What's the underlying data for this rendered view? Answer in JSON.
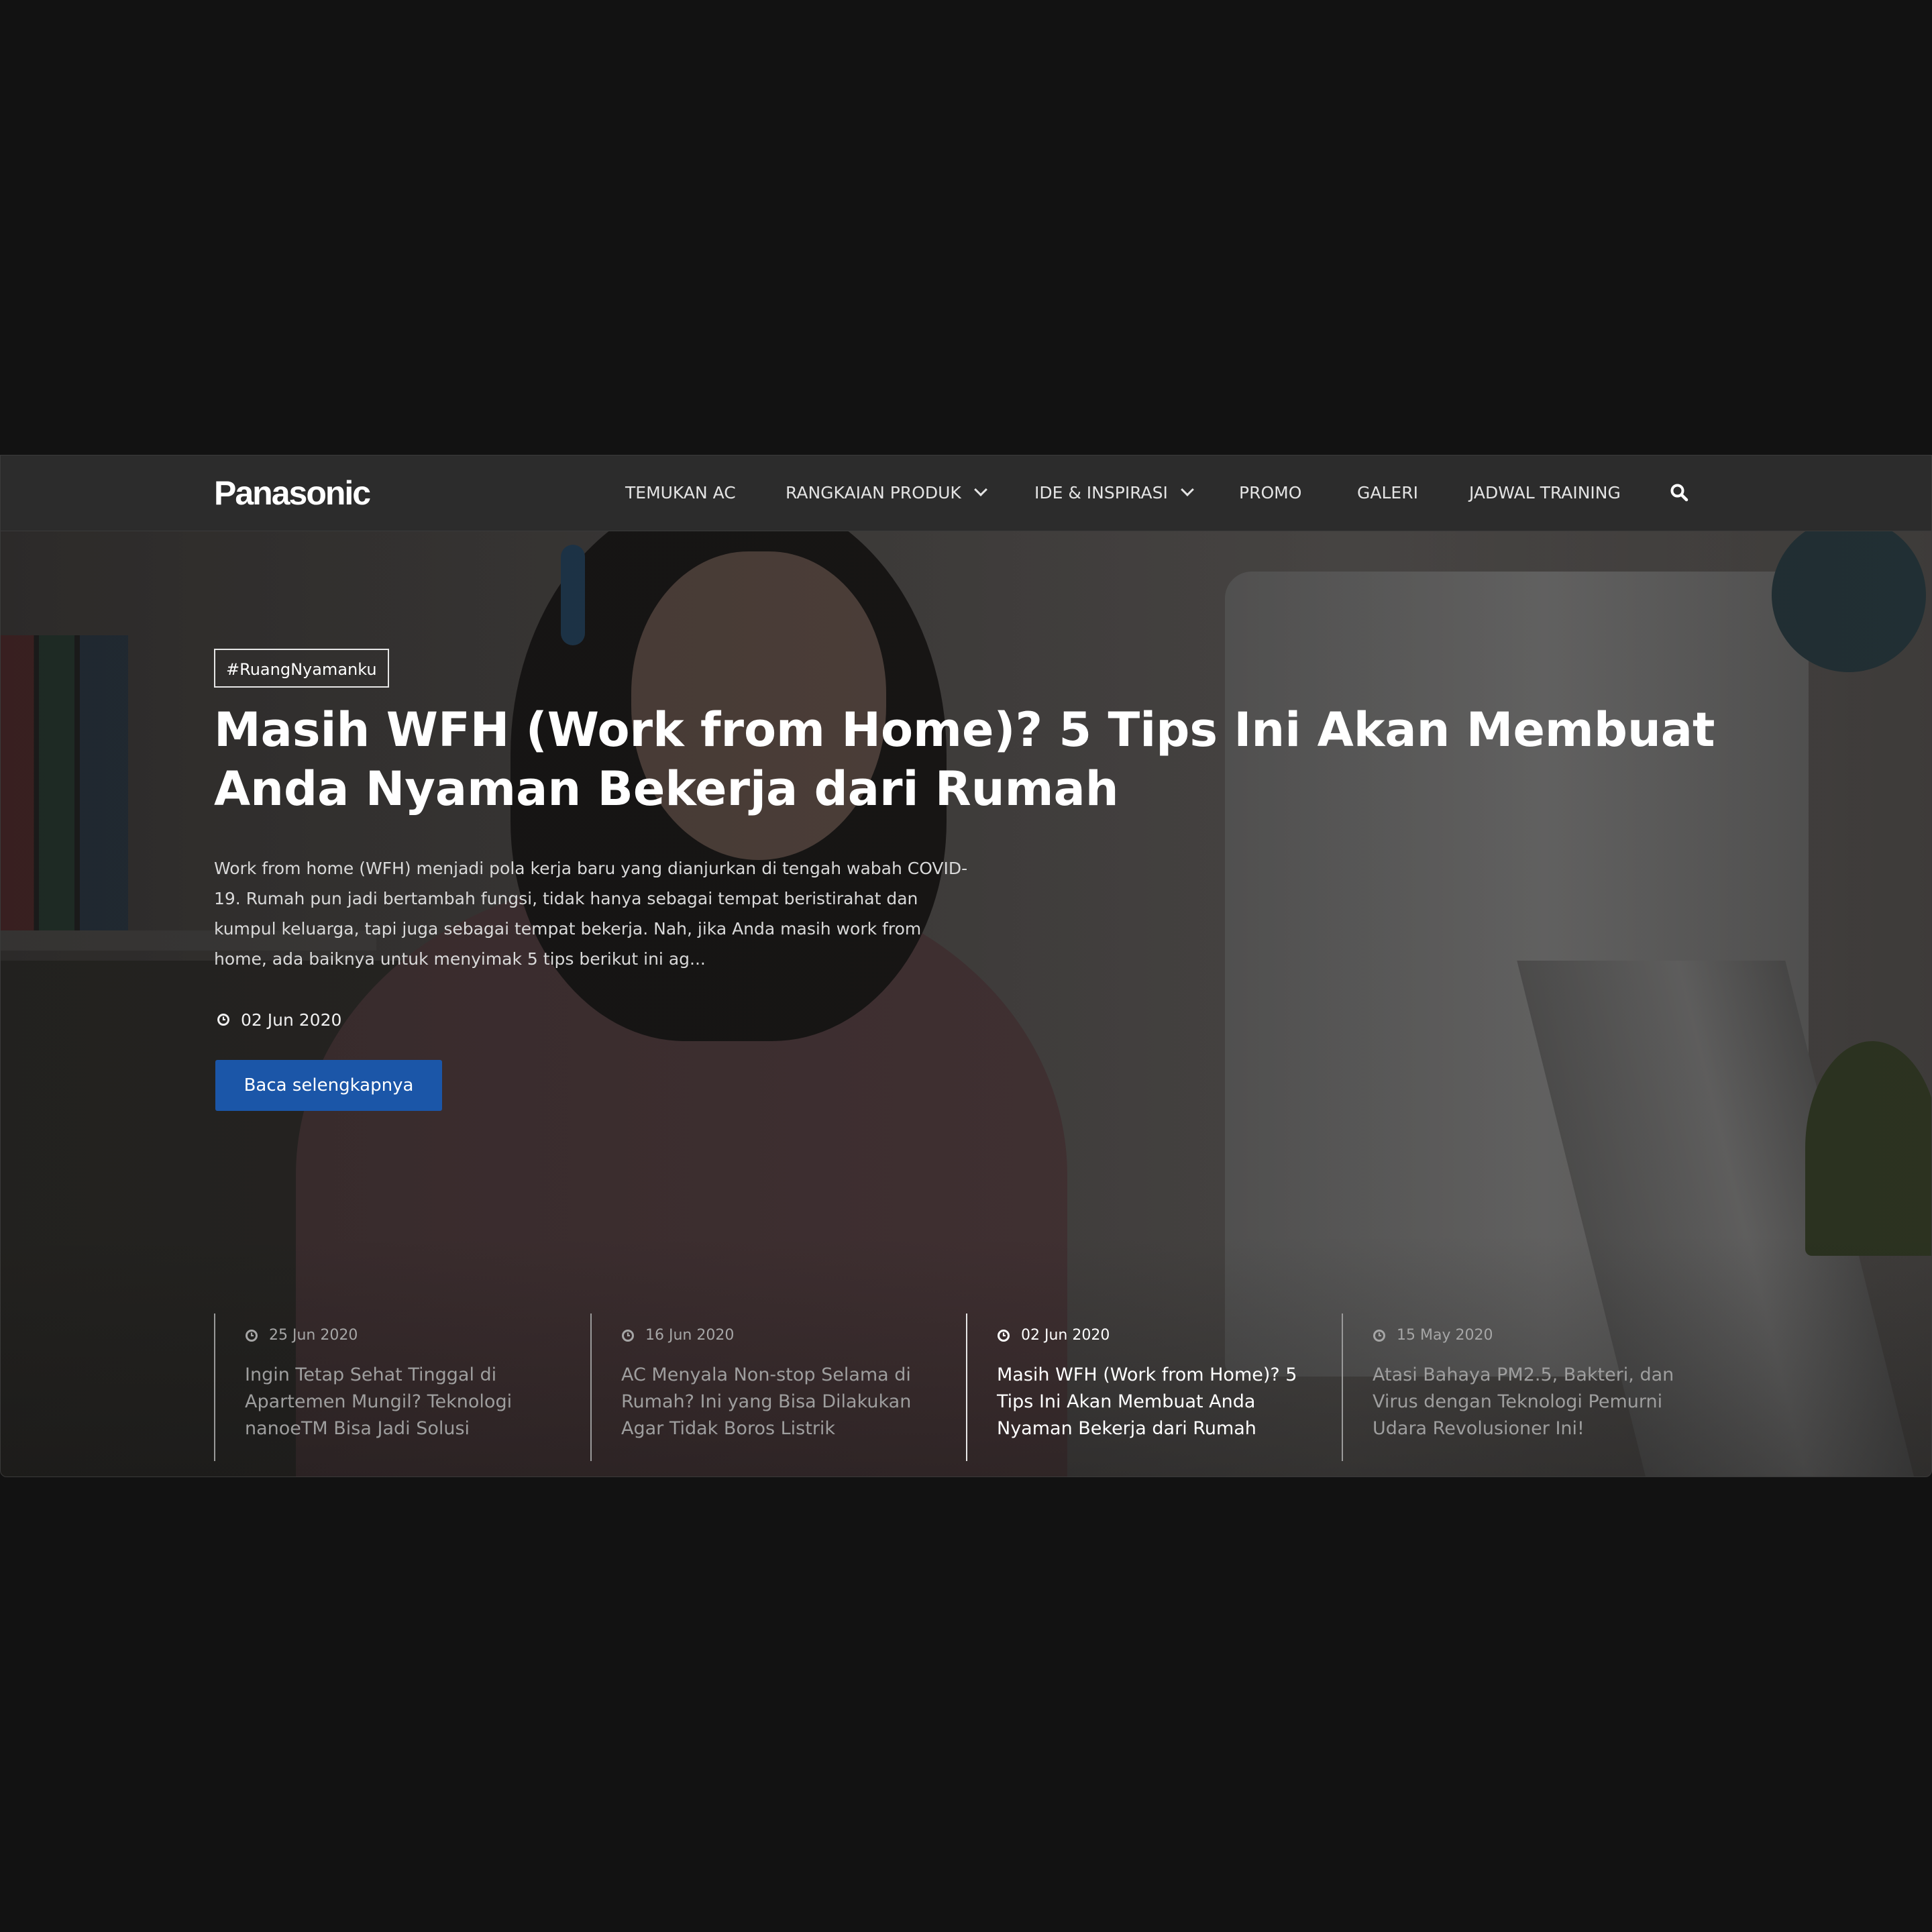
{
  "nav": {
    "logo": "Panasonic",
    "items": [
      {
        "label": "TEMUKAN AC",
        "has_dropdown": false
      },
      {
        "label": "RANGKAIAN PRODUK",
        "has_dropdown": true
      },
      {
        "label": "IDE & INSPIRASI",
        "has_dropdown": true
      },
      {
        "label": "PROMO",
        "has_dropdown": false
      },
      {
        "label": "GALERI",
        "has_dropdown": false
      },
      {
        "label": "JADWAL TRAINING",
        "has_dropdown": false
      }
    ],
    "search_icon": "search-icon"
  },
  "hero": {
    "tag": "#RuangNyamanku",
    "title": "Masih WFH (Work from Home)? 5 Tips Ini Akan Membuat Anda Nyaman Bekerja dari Rumah",
    "excerpt": "Work from home (WFH) menjadi pola kerja baru yang dianjurkan di tengah wabah COVID-19. Rumah pun jadi bertambah fungsi, tidak hanya sebagai tempat beristirahat dan kumpul keluarga, tapi juga sebagai tempat bekerja. Nah, jika Anda masih work from home, ada baiknya untuk menyimak 5 tips berikut ini ag...",
    "date": "02 Jun 2020",
    "cta_label": "Baca selengkapnya",
    "cta_color": "#1b56a8"
  },
  "articles": [
    {
      "date": "25 Jun 2020",
      "title": "Ingin Tetap Sehat Tinggal di Apartemen Mungil? Teknologi nanoeTM Bisa Jadi Solusi",
      "active": false
    },
    {
      "date": "16 Jun 2020",
      "title": "AC Menyala Non-stop Selama di Rumah? Ini yang Bisa Dilakukan Agar Tidak Boros Listrik",
      "active": false
    },
    {
      "date": "02 Jun 2020",
      "title": "Masih WFH (Work from Home)? 5 Tips Ini Akan Membuat Anda Nyaman Bekerja dari Rumah",
      "active": true
    },
    {
      "date": "15 May 2020",
      "title": "Atasi Bahaya PM2.5, Bakteri, dan Virus dengan Teknologi Pemurni Udara Revolusioner Ini!",
      "active": false
    }
  ]
}
